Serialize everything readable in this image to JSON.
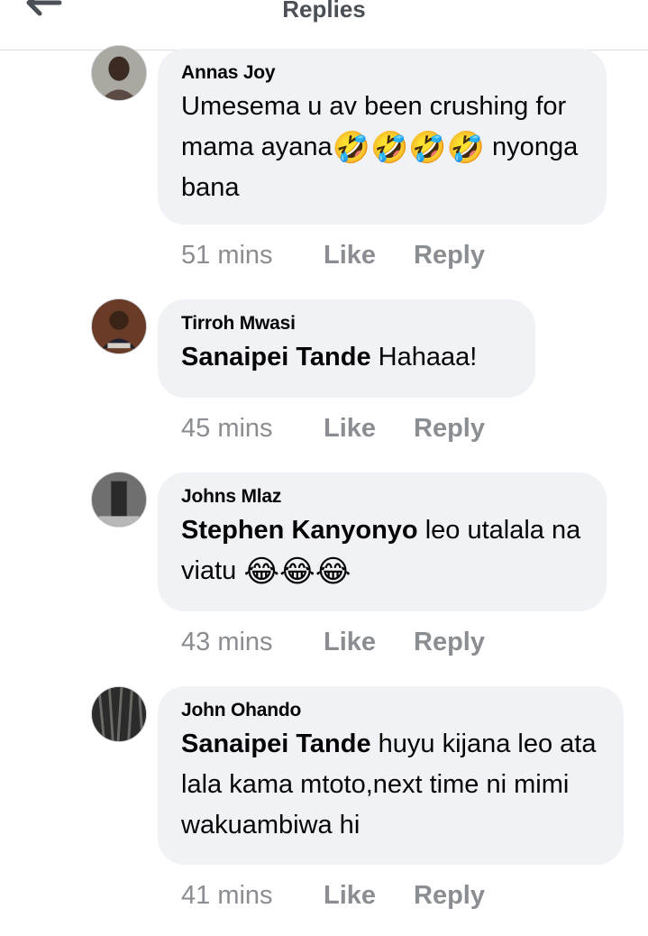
{
  "header": {
    "title": "Replies",
    "back_icon": "arrow-left-icon"
  },
  "comments": [
    {
      "author": "Annas Joy",
      "mention": "",
      "text": "Umesema u av been crushing for mama ayana",
      "emoji": "🤣🤣🤣🤣",
      "text_after": " nyonga bana",
      "time": "51 mins",
      "like": "Like",
      "reply": "Reply"
    },
    {
      "author": "Tirroh Mwasi",
      "mention": "Sanaipei Tande",
      "text": " Hahaaa!",
      "emoji": "",
      "text_after": "",
      "time": "45 mins",
      "like": "Like",
      "reply": "Reply"
    },
    {
      "author": "Johns Mlaz",
      "mention": "Stephen Kanyonyo",
      "text": " leo utalala na viatu ",
      "emoji": "😂😂😂",
      "text_after": "",
      "time": "43 mins",
      "like": "Like",
      "reply": "Reply"
    },
    {
      "author": "John Ohando",
      "mention": "Sanaipei Tande",
      "text": " huyu kijana leo ata lala kama mtoto,next time ni mimi wakuambiwa hi",
      "emoji": "",
      "text_after": "",
      "time": "41 mins",
      "like": "Like",
      "reply": "Reply"
    }
  ]
}
